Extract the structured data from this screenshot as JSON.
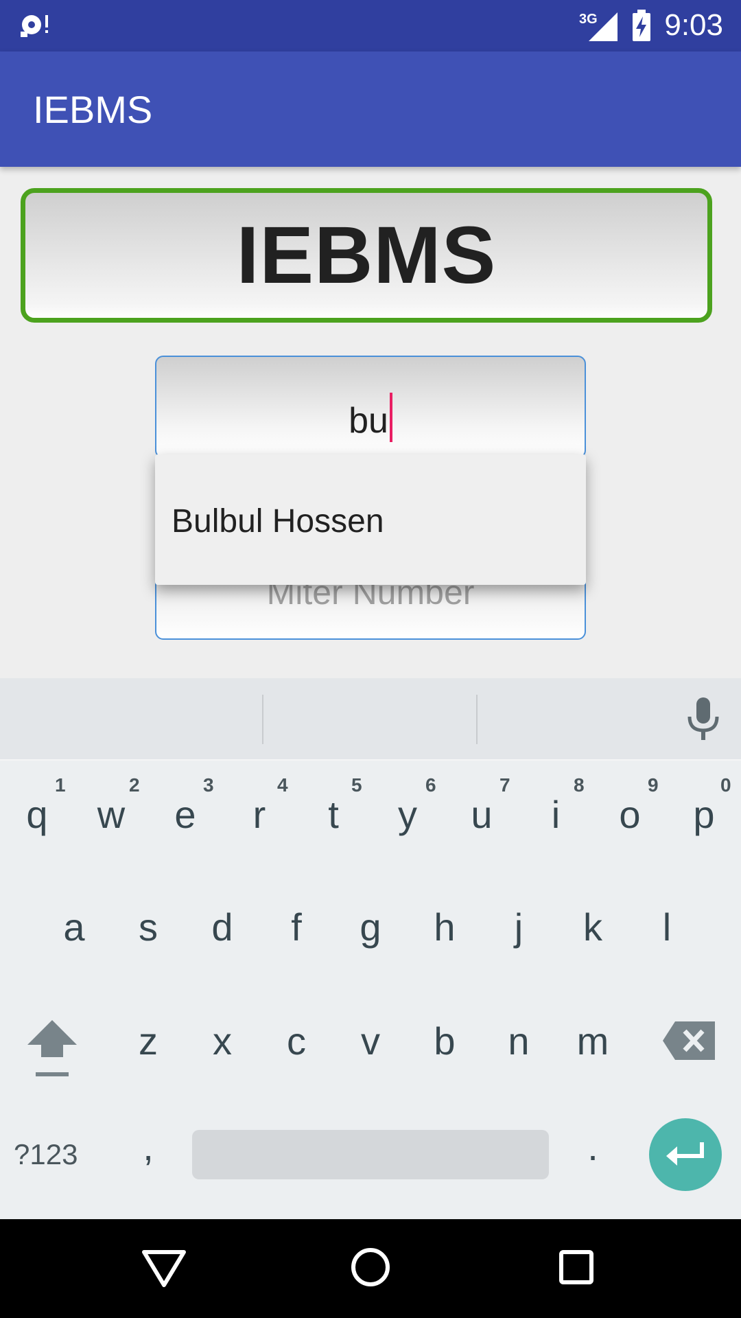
{
  "status_bar": {
    "time": "9:03",
    "network": "3G"
  },
  "app_bar": {
    "title": "IEBMS"
  },
  "header_box": {
    "label": "IEBMS"
  },
  "name_field": {
    "value": "bu"
  },
  "meter_field": {
    "placeholder": "Miter Number"
  },
  "autocomplete": {
    "items": [
      "Bulbul Hossen"
    ]
  },
  "keyboard": {
    "row1": [
      {
        "key": "q",
        "hint": "1"
      },
      {
        "key": "w",
        "hint": "2"
      },
      {
        "key": "e",
        "hint": "3"
      },
      {
        "key": "r",
        "hint": "4"
      },
      {
        "key": "t",
        "hint": "5"
      },
      {
        "key": "y",
        "hint": "6"
      },
      {
        "key": "u",
        "hint": "7"
      },
      {
        "key": "i",
        "hint": "8"
      },
      {
        "key": "o",
        "hint": "9"
      },
      {
        "key": "p",
        "hint": "0"
      }
    ],
    "row2": [
      "a",
      "s",
      "d",
      "f",
      "g",
      "h",
      "j",
      "k",
      "l"
    ],
    "row3": [
      "z",
      "x",
      "c",
      "v",
      "b",
      "n",
      "m"
    ],
    "symbols_label": "?123",
    "comma": ",",
    "period": "."
  },
  "colors": {
    "status_bar": "#303f9f",
    "app_bar": "#3f51b5",
    "header_border": "#4ca21e",
    "field_border": "#4a90d9",
    "cursor": "#e91e63",
    "enter_key": "#4db6ac"
  },
  "icons": [
    "sync-alert-icon",
    "signal-3g-icon",
    "battery-charging-icon",
    "mic-icon",
    "shift-icon",
    "backspace-icon",
    "enter-icon",
    "back-icon",
    "home-icon",
    "recents-icon"
  ]
}
